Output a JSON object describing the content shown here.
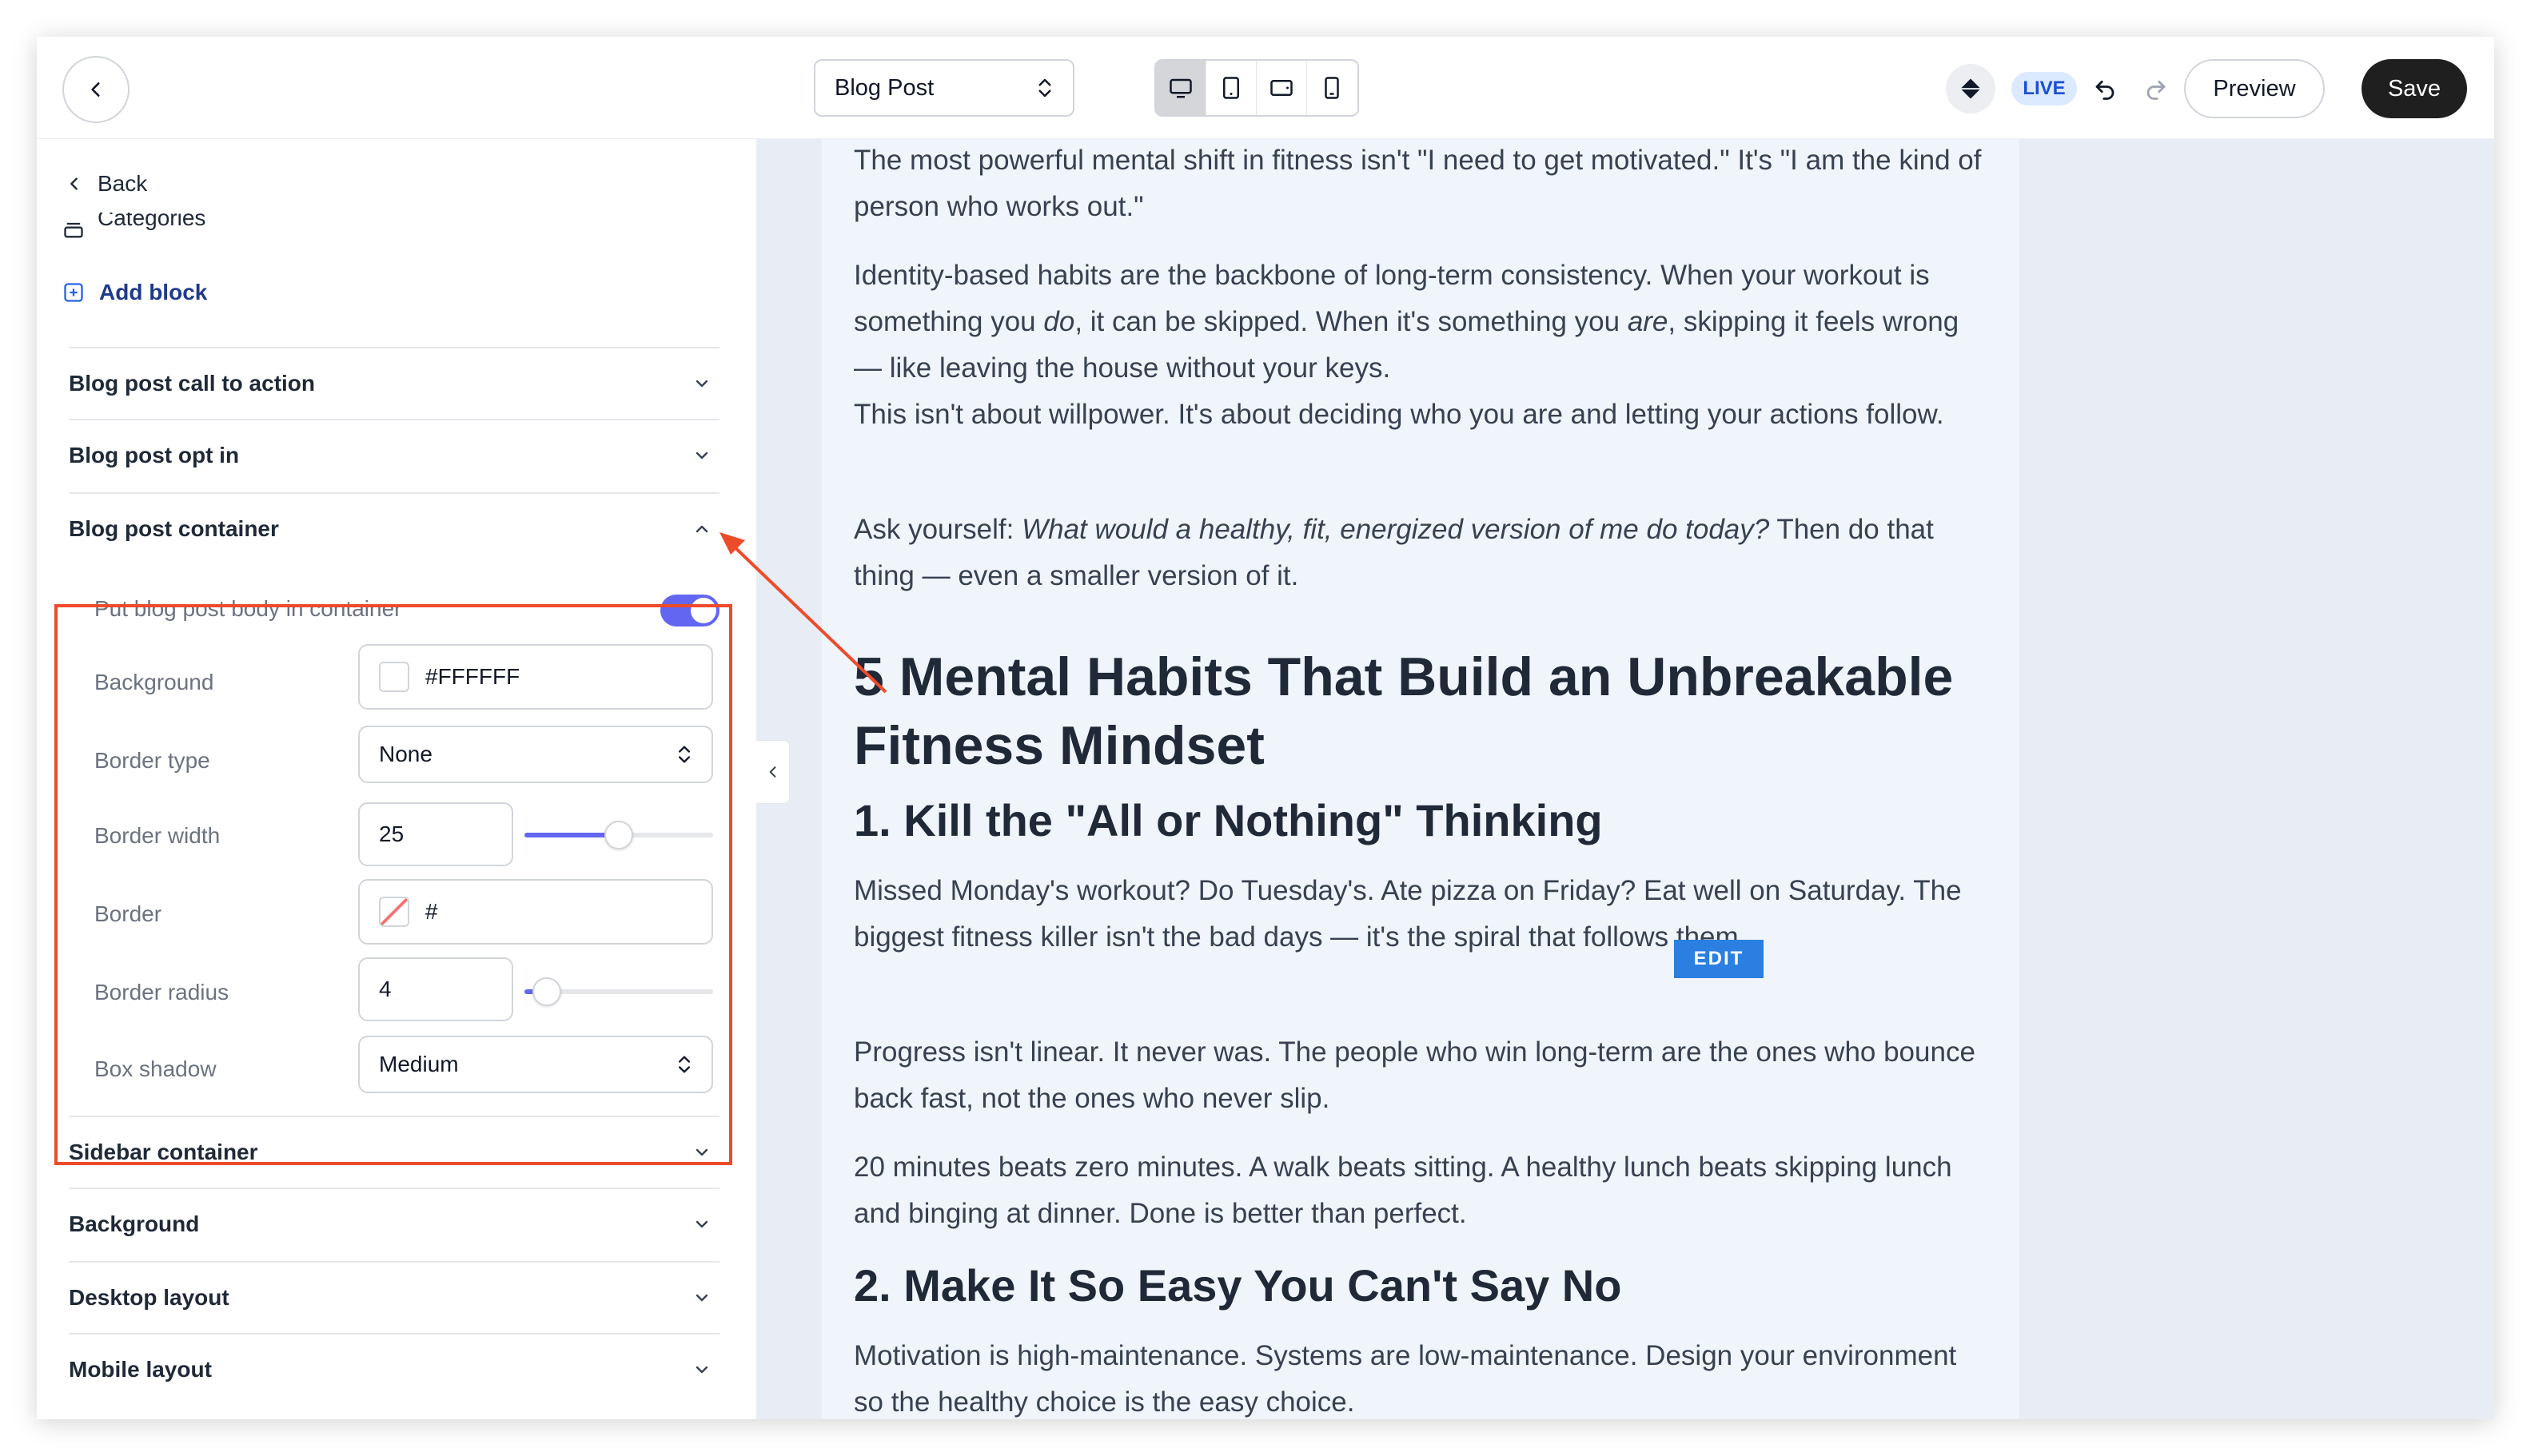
{
  "topbar": {
    "page_selector": "Blog Post",
    "live_badge": "LIVE",
    "preview_label": "Preview",
    "save_label": "Save"
  },
  "sidebar": {
    "back_label": "Back",
    "categories_label": "Categories",
    "add_block_label": "Add block",
    "sections": {
      "call_to_action": "Blog post call to action",
      "opt_in": "Blog post opt in",
      "container": "Blog post container",
      "sidebar_container": "Sidebar container",
      "background": "Background",
      "desktop_layout": "Desktop layout",
      "mobile_layout": "Mobile layout"
    },
    "container_settings": {
      "toggle_label": "Put blog post body in container",
      "toggle_on": true,
      "background_label": "Background",
      "background_value": "#FFFFFF",
      "border_type_label": "Border type",
      "border_type_value": "None",
      "border_width_label": "Border width",
      "border_width_value": "25",
      "border_width_fraction": 0.5,
      "border_label": "Border",
      "border_value": "#",
      "border_radius_label": "Border radius",
      "border_radius_value": "4",
      "border_radius_fraction": 0.12,
      "box_shadow_label": "Box shadow",
      "box_shadow_value": "Medium"
    }
  },
  "post": {
    "p1": "The most powerful mental shift in fitness isn't \"I need to get motivated.\" It's \"I am the kind of person who works out.\"",
    "p2_a": "Identity-based habits are the backbone of long-term consistency. When your workout is something you ",
    "p2_em1": "do",
    "p2_b": ", it can be skipped. When it's something you ",
    "p2_em2": "are",
    "p2_c": ", skipping it feels wrong — like leaving the house without your keys.",
    "p3": "This isn't about willpower. It's about deciding who you are and letting your actions follow.",
    "p4_a": "Ask yourself: ",
    "p4_em": "What would a healthy, fit, energized version of me do today?",
    "p4_b": " Then do that thing — even a smaller version of it.",
    "h2": "5 Mental Habits That Build an Unbreakable Fitness Mindset",
    "h3_1": "1. Kill the \"All or Nothing\" Thinking",
    "p5": "Missed Monday's workout? Do Tuesday's. Ate pizza on Friday? Eat well on Saturday. The biggest fitness killer isn't the bad days — it's the spiral that follows them.",
    "edit_badge": "EDIT",
    "p6": "Progress isn't linear. It never was. The people who win long-term are the ones who bounce back fast, not the ones who never slip.",
    "p7": "20 minutes beats zero minutes. A walk beats sitting. A healthy lunch beats skipping lunch and binging at dinner. Done is better than perfect.",
    "h3_2": "2. Make It So Easy You Can't Say No",
    "p8": "Motivation is high-maintenance. Systems are low-maintenance. Design your environment so the healthy choice is the easy choice."
  },
  "colors": {
    "accent": "#6366f1",
    "highlight": "#ee4b2b",
    "save_bg": "#1f1f1f",
    "edit_badge": "#2b7fe0"
  }
}
